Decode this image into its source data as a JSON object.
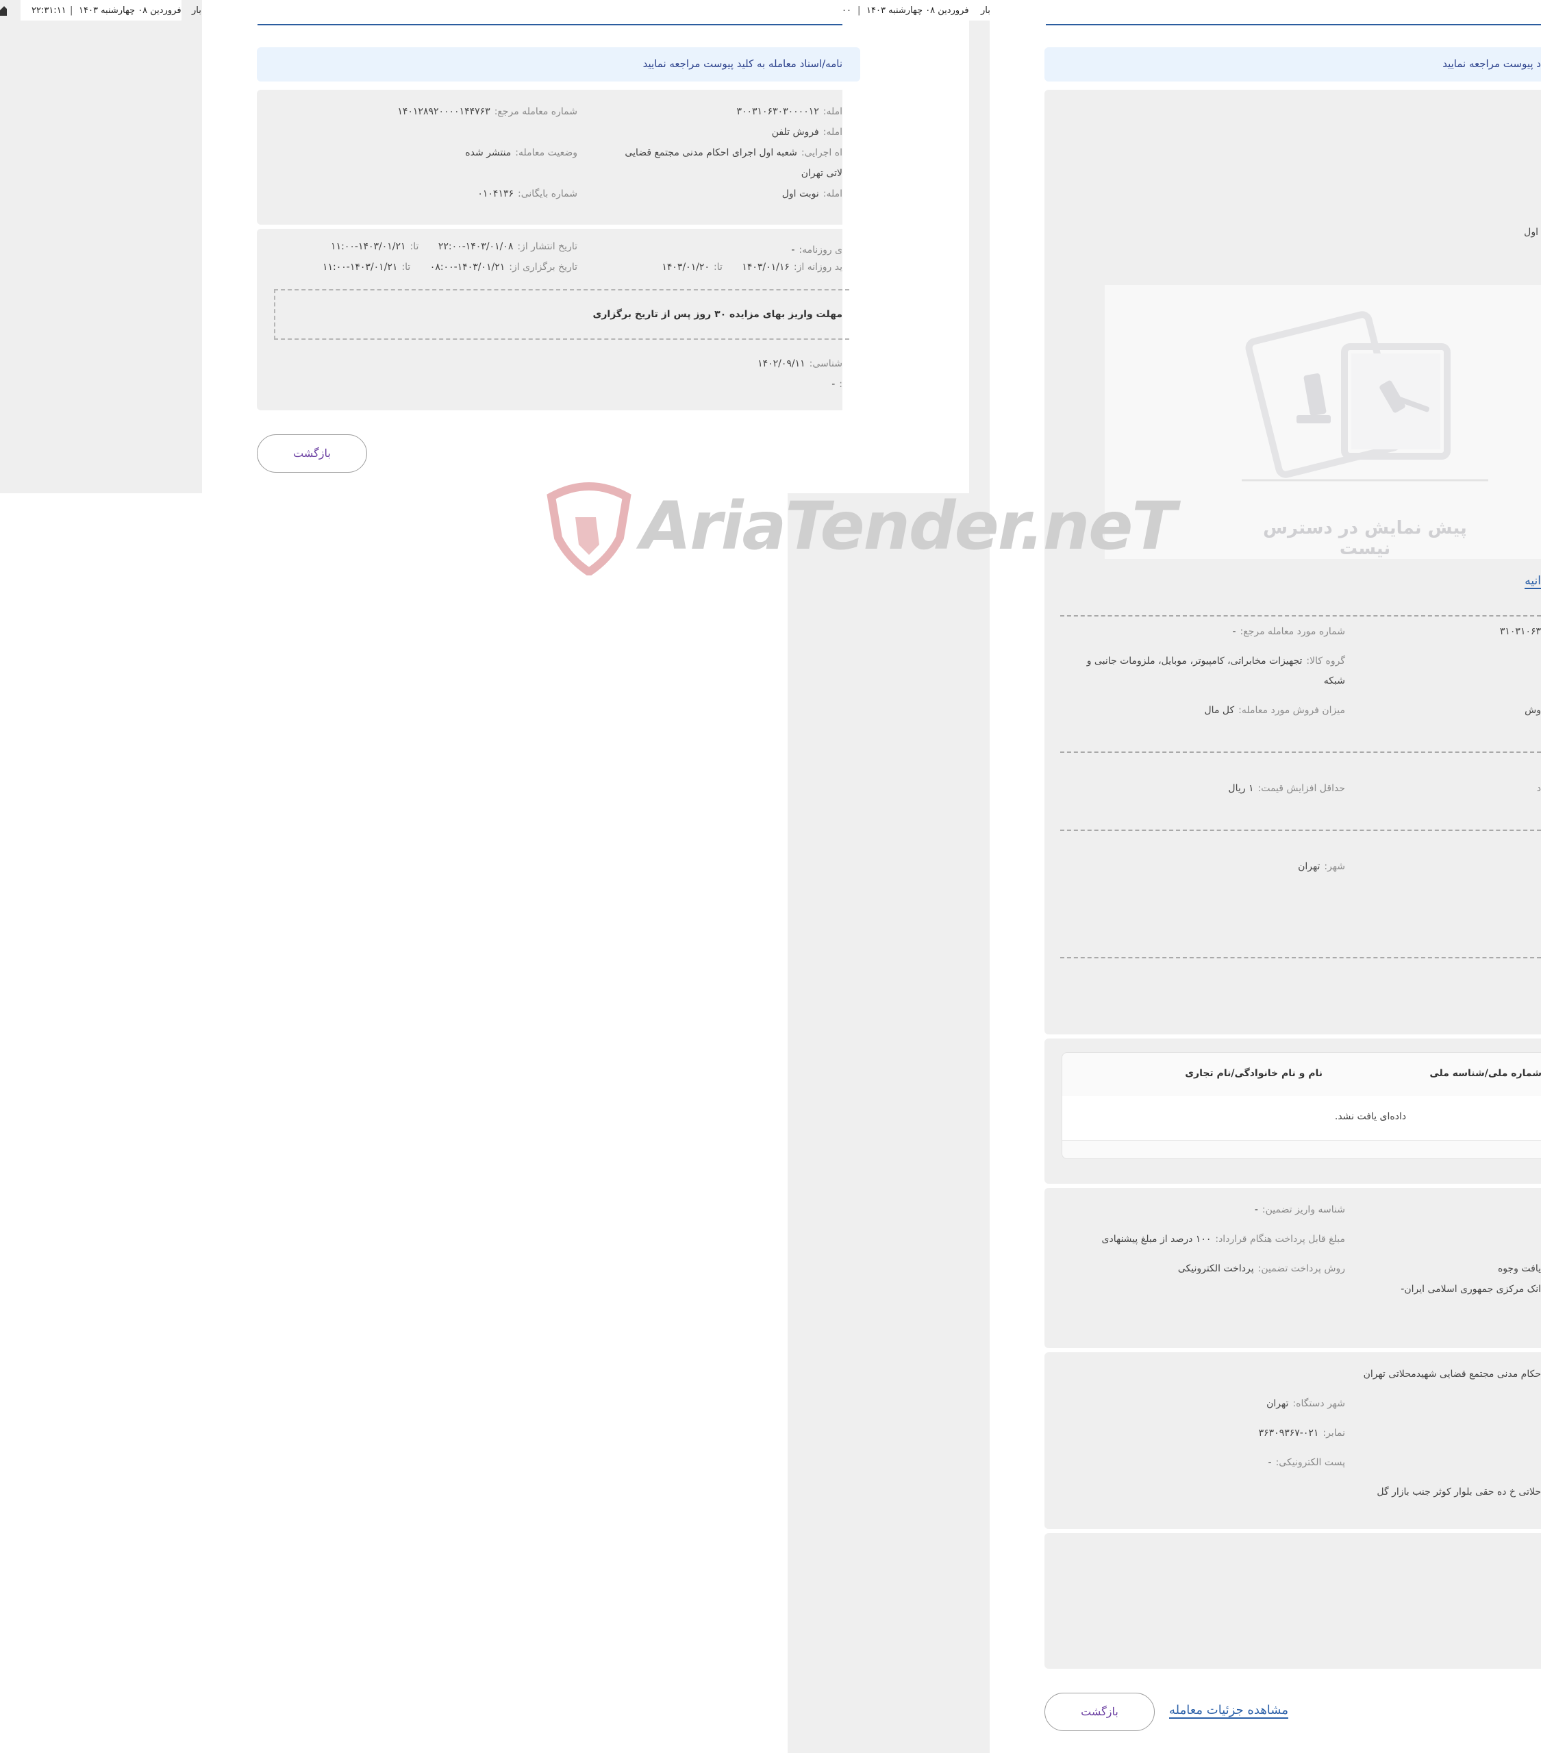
{
  "topbar": {
    "left_time": "۲۲:۳۱:۱۱",
    "left_date": "فروردین ۰۸ چهارشنبه ۱۴۰۳",
    "left_cut": "بار",
    "mid_time": "۰۰",
    "mid_date": "فروردین ۰۸ چهارشنبه ۱۴۰۳",
    "mid_cut": "بار"
  },
  "left_page": {
    "notice": "نامه/اسناد معامله به کلید پیوست مراجعه نمایید",
    "info": {
      "ref_no_label": "شماره معامله مرجع:",
      "ref_no_value": "۱۴۰۱۲۸۹۲۰۰۰۰۱۴۴۷۶۳",
      "deal_no_label": "امله:",
      "deal_no_value": "۳۰۰۳۱۰۶۳۰۳۰۰۰۰۱۲",
      "subject_label": "امله:",
      "subject_value": "فروش تلفن",
      "status_label": "وضعیت معامله:",
      "status_value": "منتشر شده",
      "exec_label": "اه اجرایی:",
      "exec_value_line1": "شعبه اول اجرای احکام مدنی مجتمع قضایی",
      "exec_value_line2": "لاتی تهران",
      "archive_label": "شماره بایگانی:",
      "archive_value": "۰۱۰۴۱۳۶",
      "round_label": "امله:",
      "round_value": "نوبت اول"
    },
    "dates": {
      "publish_label": "تاریخ انتشار از:",
      "publish_from": "۱۴۰۳/۰۱/۰۸-۲۲:۰۰",
      "publish_to_label": "تا:",
      "publish_to": "۱۴۰۳/۰۱/۲۱-۱۱:۰۰",
      "newspaper_label": "ی روزنامه:",
      "newspaper_value": "-",
      "hold_label": "تاریخ برگزاری از:",
      "hold_from": "۱۴۰۳/۰۱/۲۱-۰۸:۰۰",
      "hold_to_label": "تا:",
      "hold_to": "۱۴۰۳/۰۱/۲۱-۱۱:۰۰",
      "daily_label": "ید روزانه از:",
      "daily_from": "۱۴۰۳/۰۱/۱۶",
      "daily_to_label": "تا:",
      "daily_to": "۱۴۰۳/۰۱/۲۰",
      "deadline_note": "مهلت واریز بهای مزایده ۳۰ روز پس از تاریخ برگزاری",
      "expert_label": "شناسی:",
      "expert_value": "۱۴۰۲/۰۹/۱۱",
      "extra_label": ":",
      "extra_value": "-"
    },
    "back_button": "بازگشت"
  },
  "right_page": {
    "notice": "د پیوست مراجعه نمایید",
    "frag_round": "اول",
    "preview_unavailable": "پیش نمایش در دسترس نیست",
    "frag_link": "انیه",
    "item": {
      "ref_item_label": "شماره مورد معامله مرجع:",
      "ref_item_value": "-",
      "item_no_frag": "۳۱۰۳۱۰۶۳",
      "group_label": "گروه کالا:",
      "group_value_line1": "تجهیزات مخابراتی، کامپیوتر، موبایل، ملزومات جانبی و",
      "group_value_line2": "شبکه",
      "sale_amount_label": "میزان فروش مورد معامله:",
      "sale_amount_value": "کل مال",
      "sale_frag": "وش",
      "min_increase_label": "حداقل افزایش قیمت:",
      "min_increase_value": "۱ ریال",
      "min_frag": "د",
      "city_label": "شهر:",
      "city_value": "تهران"
    },
    "table": {
      "col_id": "شماره ملی/شناسه ملی",
      "col_name": "نام و نام خانوادگی/نام تجاری",
      "empty": "داده‌ای یافت نشد."
    },
    "payment": {
      "deposit_id_label": "شناسه واریز تضمین:",
      "deposit_id_value": "-",
      "contract_pay_label": "مبلغ قابل پرداخت هنگام قرارداد:",
      "contract_pay_value": "۱۰۰ درصد از مبلغ پیشنهادی",
      "method_label": "روش پرداخت تضمین:",
      "method_value": "پرداخت الکترونیکی",
      "receive_frag": "یافت وجوه",
      "bank_frag": "انک مرکزی جمهوری اسلامی ایران-"
    },
    "agency": {
      "name_frag": "حکام مدنی مجتمع قضایی شهیدمحلاتی تهران",
      "city_label": "شهر دستگاه:",
      "city_value": "تهران",
      "fax_label": "نمابر:",
      "fax_value": "۰۲۱-۳۶۳۰۹۳۶۷",
      "email_label": "پست الکترونیکی:",
      "email_value": "-",
      "address_frag": "حلاتی خ ده حقی بلوار کوثر جنب بازار گل"
    },
    "details_link": "مشاهده جزئیات معامله",
    "back_button": "بازگشت"
  },
  "watermark": {
    "text": "AriaTender.neT",
    "colors": {
      "logo": "#e3a7aa",
      "text": "#c9c9c9"
    }
  }
}
